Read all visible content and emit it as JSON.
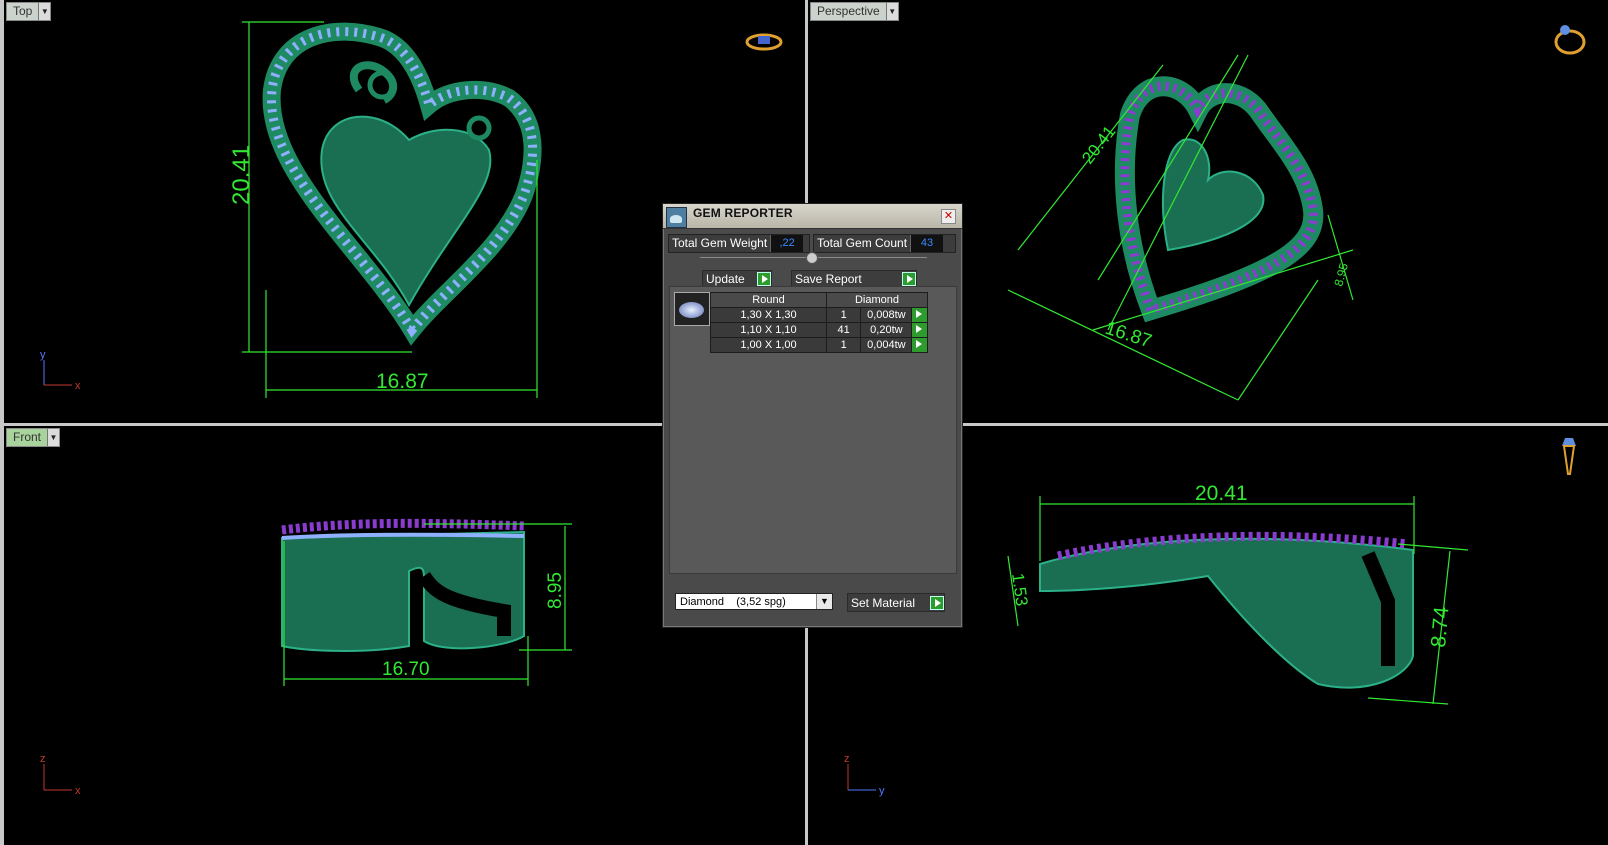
{
  "viewports": {
    "top": {
      "label": "Top",
      "dims": {
        "height": "20.41",
        "width": "16.87"
      },
      "axes": {
        "a": "y",
        "b": "x"
      }
    },
    "perspective": {
      "label": "Perspective",
      "dims": {
        "a": "20.41",
        "b": "16.87",
        "c": "8.95"
      }
    },
    "front": {
      "label": "Front",
      "dims": {
        "height": "8.95",
        "width": "16.70"
      },
      "axes": {
        "a": "z",
        "b": "x"
      }
    },
    "right": {
      "dims": {
        "width": "20.41",
        "height": "8.74",
        "left": "1.53"
      },
      "axes": {
        "a": "z",
        "b": "y"
      }
    }
  },
  "gem_reporter": {
    "title": "GEM REPORTER",
    "total_weight_label": "Total Gem Weight",
    "total_weight_value": ",22",
    "total_count_label": "Total Gem Count",
    "total_count_value": "43",
    "update_label": "Update",
    "save_label": "Save Report",
    "table": {
      "headers": [
        "Round",
        "Diamond"
      ],
      "rows": [
        {
          "size": "1,30 X 1,30",
          "count": "1",
          "weight": "0,008tw"
        },
        {
          "size": "1,10 X 1,10",
          "count": "41",
          "weight": "0,20tw"
        },
        {
          "size": "1,00 X 1,00",
          "count": "1",
          "weight": "0,004tw"
        }
      ]
    },
    "material_value": "Diamond    (3,52 spg)",
    "set_material_label": "Set Material"
  },
  "colors": {
    "dimension": "#32e832",
    "metal": "#1e8a62",
    "gem": "#8fb0ff",
    "prong": "#8a3ccf"
  }
}
